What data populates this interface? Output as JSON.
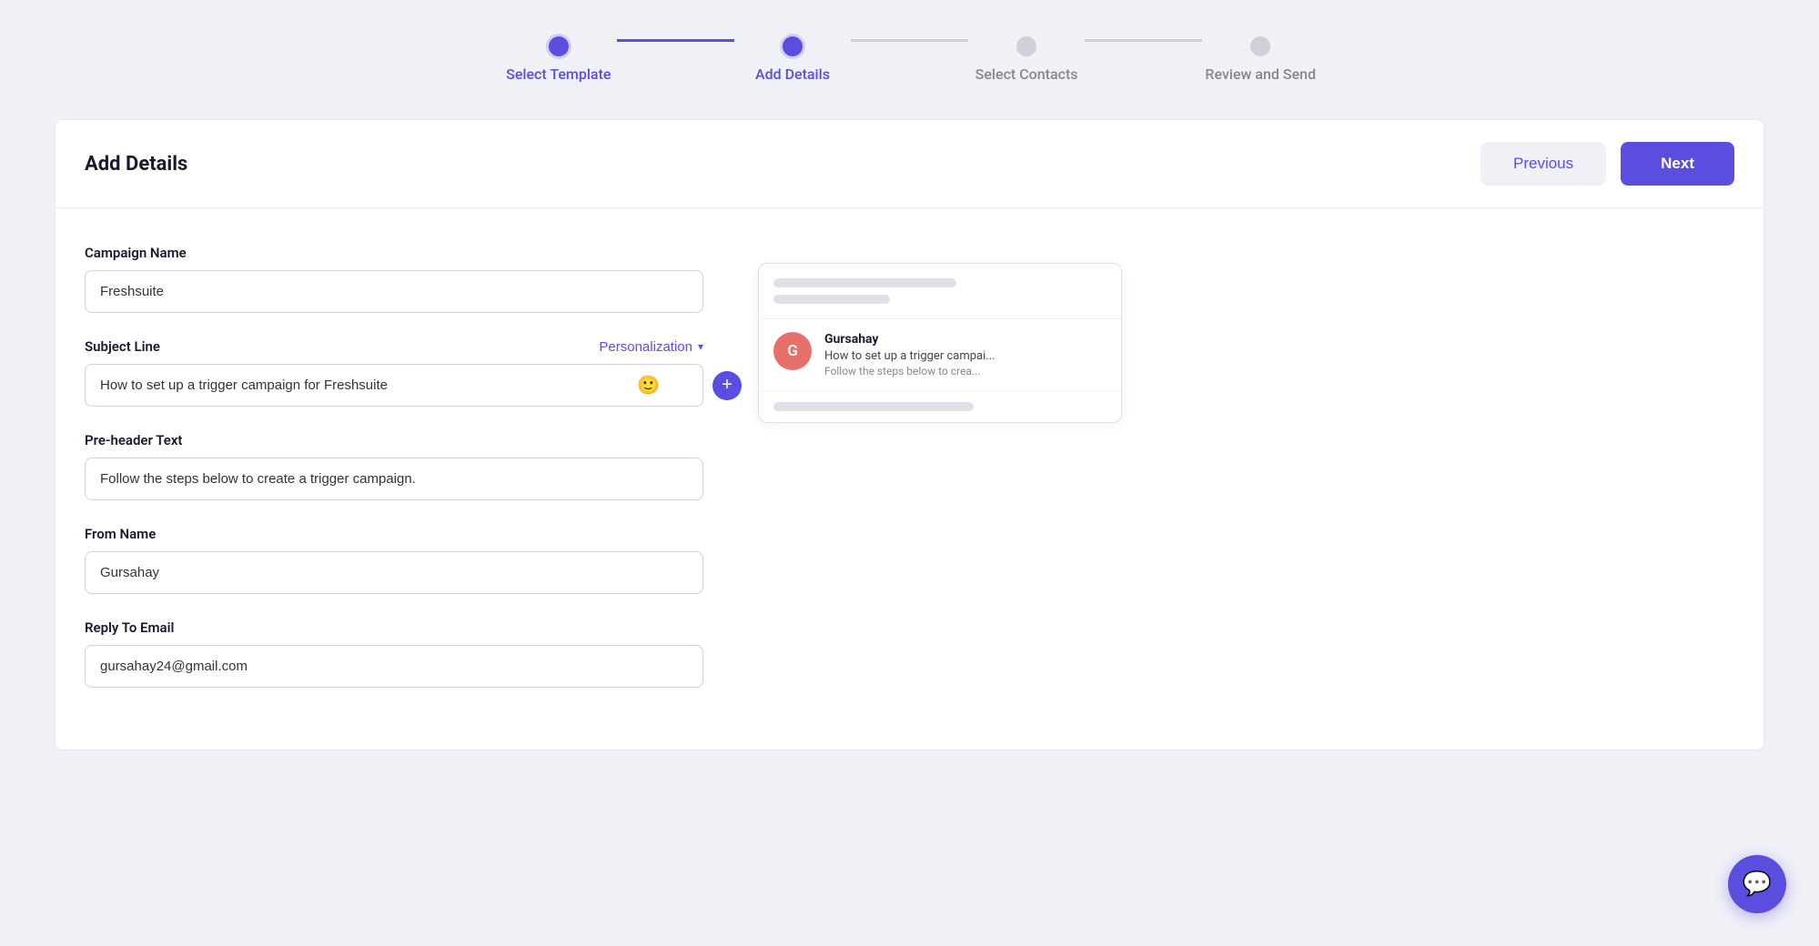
{
  "stepper": {
    "steps": [
      {
        "id": "select-template",
        "label": "Select Template",
        "state": "completed"
      },
      {
        "id": "add-details",
        "label": "Add Details",
        "state": "active"
      },
      {
        "id": "select-contacts",
        "label": "Select Contacts",
        "state": "inactive"
      },
      {
        "id": "review-and-send",
        "label": "Review and Send",
        "state": "inactive"
      }
    ]
  },
  "card": {
    "title": "Add Details",
    "buttons": {
      "previous": "Previous",
      "next": "Next"
    }
  },
  "form": {
    "campaign_name_label": "Campaign Name",
    "campaign_name_value": "Freshsuite",
    "subject_line_label": "Subject Line",
    "subject_line_value": "How to set up a trigger campaign for Freshsuite",
    "personalization_label": "Personalization",
    "preheader_label": "Pre-header Text",
    "preheader_value": "Follow the steps below to create a trigger campaign.",
    "from_name_label": "From Name",
    "from_name_value": "Gursahay",
    "reply_to_email_label": "Reply To Email",
    "reply_to_email_value": "gursahay24@gmail.com"
  },
  "preview": {
    "avatar_letter": "G",
    "from_name": "Gursahay",
    "subject_preview": "How to set up a trigger campai...",
    "preheader_preview": "Follow the steps below to crea..."
  },
  "chat": {
    "icon": "💬"
  }
}
